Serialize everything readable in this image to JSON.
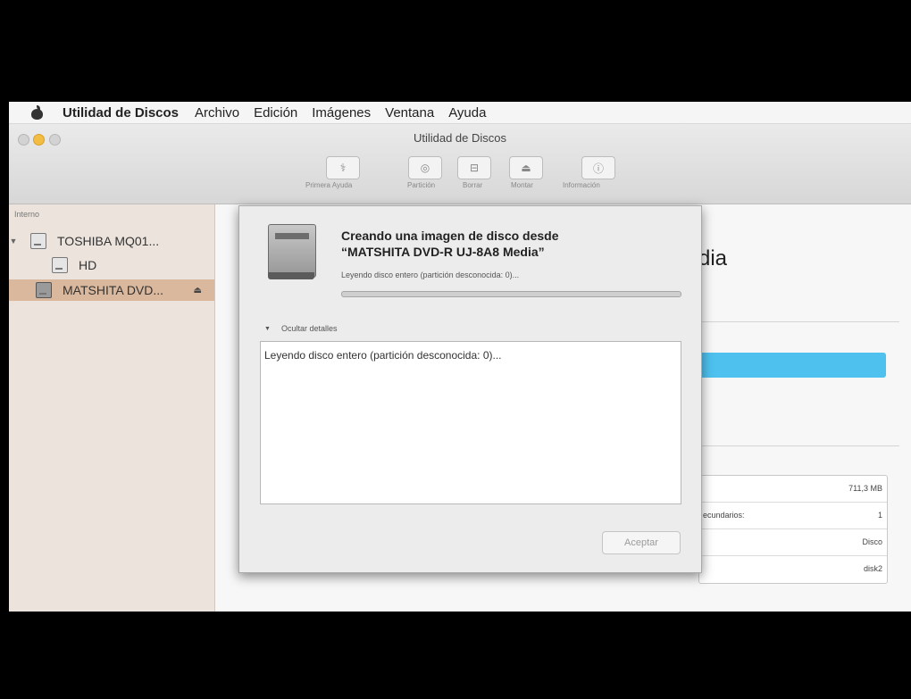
{
  "menubar": {
    "apple_icon": "apple-icon",
    "app_name": "Utilidad de Discos",
    "items": [
      "Archivo",
      "Edición",
      "Imágenes",
      "Ventana",
      "Ayuda"
    ]
  },
  "window": {
    "title": "Utilidad de Discos"
  },
  "toolbar": {
    "buttons": [
      {
        "label": "Primera Ayuda",
        "icon": "stethoscope-icon",
        "glyph": "⚕"
      },
      {
        "label": "Partición",
        "icon": "partition-icon",
        "glyph": "◎"
      },
      {
        "label": "Borrar",
        "icon": "erase-icon",
        "glyph": "⊟"
      },
      {
        "label": "Montar",
        "icon": "mount-icon",
        "glyph": "⏏"
      },
      {
        "label": "Información",
        "icon": "info-icon",
        "glyph": "ⓘ"
      }
    ]
  },
  "sidebar": {
    "section": "Interno",
    "items": [
      {
        "label": "TOSHIBA MQ01...",
        "icon": "hard-drive-icon",
        "expanded": true
      },
      {
        "label": "HD",
        "icon": "volume-icon"
      },
      {
        "label": "MATSHITA DVD...",
        "icon": "optical-drive-icon",
        "selected": true,
        "eject": "⏏"
      }
    ]
  },
  "main": {
    "title_fragment": "dia",
    "info_rows": [
      {
        "key": "",
        "value": "711,3 MB"
      },
      {
        "key": "ecundarios:",
        "value": "1"
      },
      {
        "key": "",
        "value": "Disco"
      },
      {
        "key": "",
        "value": "disk2"
      }
    ]
  },
  "dialog": {
    "icon": "dvd-drive-icon",
    "title_line1": "Creando una imagen de disco desde",
    "title_line2": "“MATSHITA DVD-R UJ-8A8 Media”",
    "status": "Leyendo disco entero (partición desconocida: 0)...",
    "progress_fraction": 0.0,
    "details_toggle": "Ocultar detalles",
    "log": "Leyendo disco entero (partición desconocida: 0)...",
    "accept": "Aceptar"
  },
  "colors": {
    "accent_blue": "#4ec1ef",
    "sidebar_selection": "#dab89d",
    "minimize_button": "#f3bd43"
  }
}
